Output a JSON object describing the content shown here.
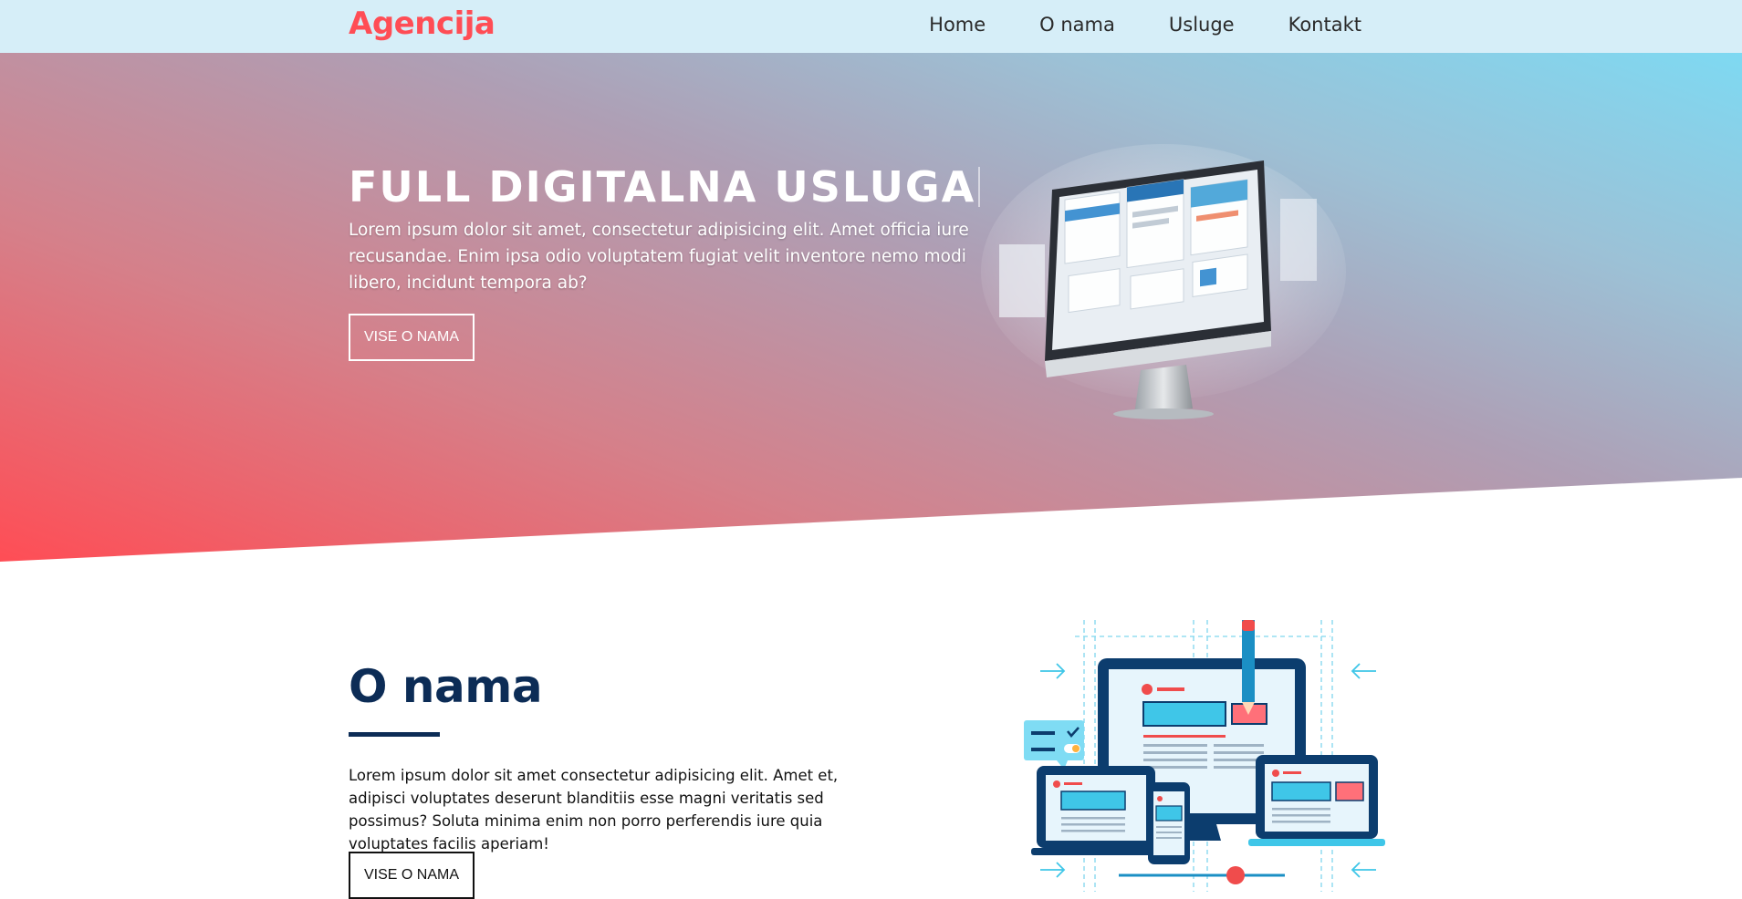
{
  "navbar": {
    "logo": "Agencija",
    "links": [
      "Home",
      "O nama",
      "Usluge",
      "Kontakt"
    ]
  },
  "hero": {
    "title": "FULL DIGITALNA USLUGA",
    "text": "Lorem ipsum dolor sit amet, consectetur adipisicing elit. Amet officia iure recusandae. Enim ipsa odio voluptatem fugiat velit inventore nemo modi libero, incidunt tempora ab?",
    "button": "VISE O NAMA",
    "image_icon": "monitor-websites-illustration"
  },
  "about": {
    "title": "O nama",
    "text": "Lorem ipsum dolor sit amet consectetur adipisicing elit. Amet et, adipisci voluptates deserunt blanditiis esse magni veritatis sed possimus? Soluta minima enim non porro perferendis iure quia voluptates facilis aperiam!",
    "button": "VISE O NAMA",
    "image_icon": "responsive-devices-illustration"
  },
  "colors": {
    "brand": "#ff4d55",
    "navy": "#0c2c56",
    "nav_bg": "#d6eef8",
    "accent_cyan": "#3fc6e8"
  }
}
